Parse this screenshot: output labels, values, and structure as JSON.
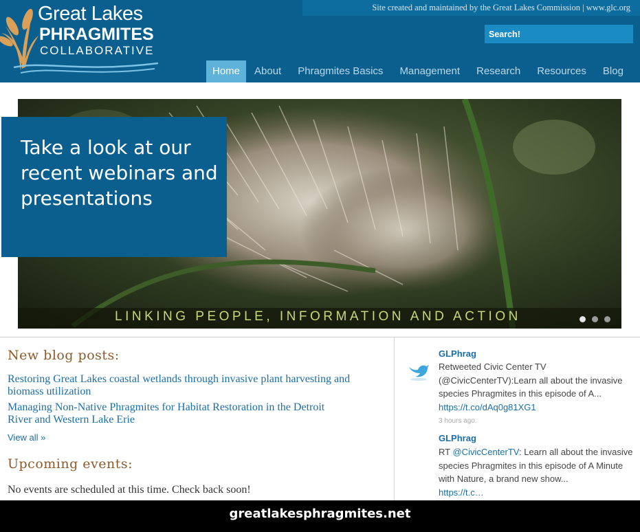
{
  "header": {
    "tagline": "Site created and maintained by the Great Lakes Commission | www.glc.org",
    "search_placeholder": "Search!",
    "logo": {
      "line1": "Great Lakes",
      "line2": "PHRAGMITES",
      "line3": "COLLABORATIVE",
      "icon": "phragmites-plume-icon"
    }
  },
  "nav": {
    "items": [
      {
        "label": "Home",
        "active": true
      },
      {
        "label": "About"
      },
      {
        "label": "Phragmites Basics"
      },
      {
        "label": "Management"
      },
      {
        "label": "Research"
      },
      {
        "label": "Resources"
      },
      {
        "label": "Blog"
      }
    ]
  },
  "hero": {
    "callout": "Take a look at our recent webinars and presentations",
    "caption": "LINKING PEOPLE, INFORMATION AND ACTION",
    "slide_count": 3,
    "active_slide": 1
  },
  "blog": {
    "heading": "New blog posts:",
    "posts": [
      {
        "title": "Restoring Great Lakes coastal wetlands through invasive plant harvesting and biomass utilization"
      },
      {
        "title": "Managing Non-Native Phragmites for Habitat Restoration in the Detroit River and Western Lake Erie"
      }
    ],
    "view_all": "View all »"
  },
  "events": {
    "heading": "Upcoming events:",
    "empty_text": "No events are scheduled at this time. Check back soon!"
  },
  "twitter": {
    "icon": "twitter-bird-icon",
    "tweets": [
      {
        "user": "GLPhrag",
        "text": "Retweeted Civic Center TV (@CivicCenterTV):Learn all about the invasive species Phragmites in this episode of A...",
        "link": "https://t.co/dAq0g81XG1",
        "time": "3 hours ago."
      },
      {
        "user": "GLPhrag",
        "text_prefix": "RT ",
        "mention": "@CivicCenterTV",
        "text": ": Learn all about the invasive species Phragmites in this episode of A Minute with Nature, a brand new show...",
        "link": "https://t.c…"
      }
    ]
  },
  "footer": {
    "url": "greatlakesphragmites.net"
  },
  "colors": {
    "brand_blue": "#0a5f8e",
    "nav_active": "#5fb2d9",
    "search_bg": "#1b8bc3",
    "heading_brown": "#8b5a2b",
    "link_blue": "#1a6ea8",
    "caption_green": "#c8d77a"
  }
}
